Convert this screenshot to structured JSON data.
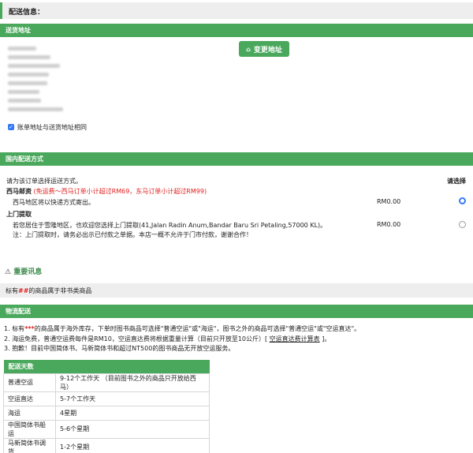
{
  "page_header": {
    "title": "配送信息："
  },
  "shipping_address": {
    "bar_title": "送货地址",
    "change_button": "变更地址",
    "same_address_label": "账单地址与送货地址相同",
    "same_address_checked": true
  },
  "domestic": {
    "bar_title": "国内配送方式",
    "instruction": "请为该订单选择运送方式。",
    "select_header": "请选择",
    "options": [
      {
        "name": "西马邮资",
        "promo": "(免运费～西马订单小计超过RM69，东马订单小计超过RM99)",
        "desc": "西马地区将以快递方式寄出。",
        "price": "RM0.00",
        "selected": true
      },
      {
        "name": "上门提取",
        "desc": "若您居住于雪隆地区，也欢迎您选择上门提取(41,Jalan Radin Anum,Bandar Baru Sri Petaling,57000 KL)。",
        "note": "注：上门提取时，请务必出示已付款之单据。本店一概不允许于门市付款，谢谢合作！",
        "price": "RM0.00",
        "selected": false
      }
    ]
  },
  "important": {
    "title": "重要讯息",
    "notice_pre": "标有",
    "notice_mark": "##",
    "notice_post": "的商品属于非书类商品"
  },
  "logistics": {
    "bar_title": "物流配送",
    "items": [
      {
        "num": "1.",
        "pre": "标有",
        "mark": "***",
        "post": "的商品属于海外库存，下单时图书商品可选择\"普通空运\"或\"海运\"，图书之外的商品可选择\"普通空运\"或\"空运直达\"。"
      },
      {
        "num": "2.",
        "pre": "海运免费，普通空运费每件是RM10，空运直达费将根据重量计算（目前只开放至10公斤）[ ",
        "link": "空运直达费计算表",
        "post": " ]。"
      },
      {
        "num": "3.",
        "pre": "抱歉！目前中国简体书、马新简体书和超过NT500的图书商品无开放空运服务。"
      }
    ]
  },
  "delivery_days": {
    "header": "配送天数",
    "rows": [
      {
        "method": "普通空运",
        "days": "9-12个工作天 （目前图书之外的商品只开放给西马）"
      },
      {
        "method": "空运直达",
        "days": "5-7个工作天"
      },
      {
        "method": "海运",
        "days": "4星期"
      },
      {
        "method": "中国简体书船运",
        "days": "5-6个星期"
      },
      {
        "method": "马新简体书调货",
        "days": "1-2个星期"
      }
    ]
  },
  "colors": {
    "accent": "#4aa85c",
    "red": "#e02020",
    "radio": "#3478f6"
  },
  "icons": {
    "change_button": "home-icon",
    "important": "warning-icon"
  }
}
